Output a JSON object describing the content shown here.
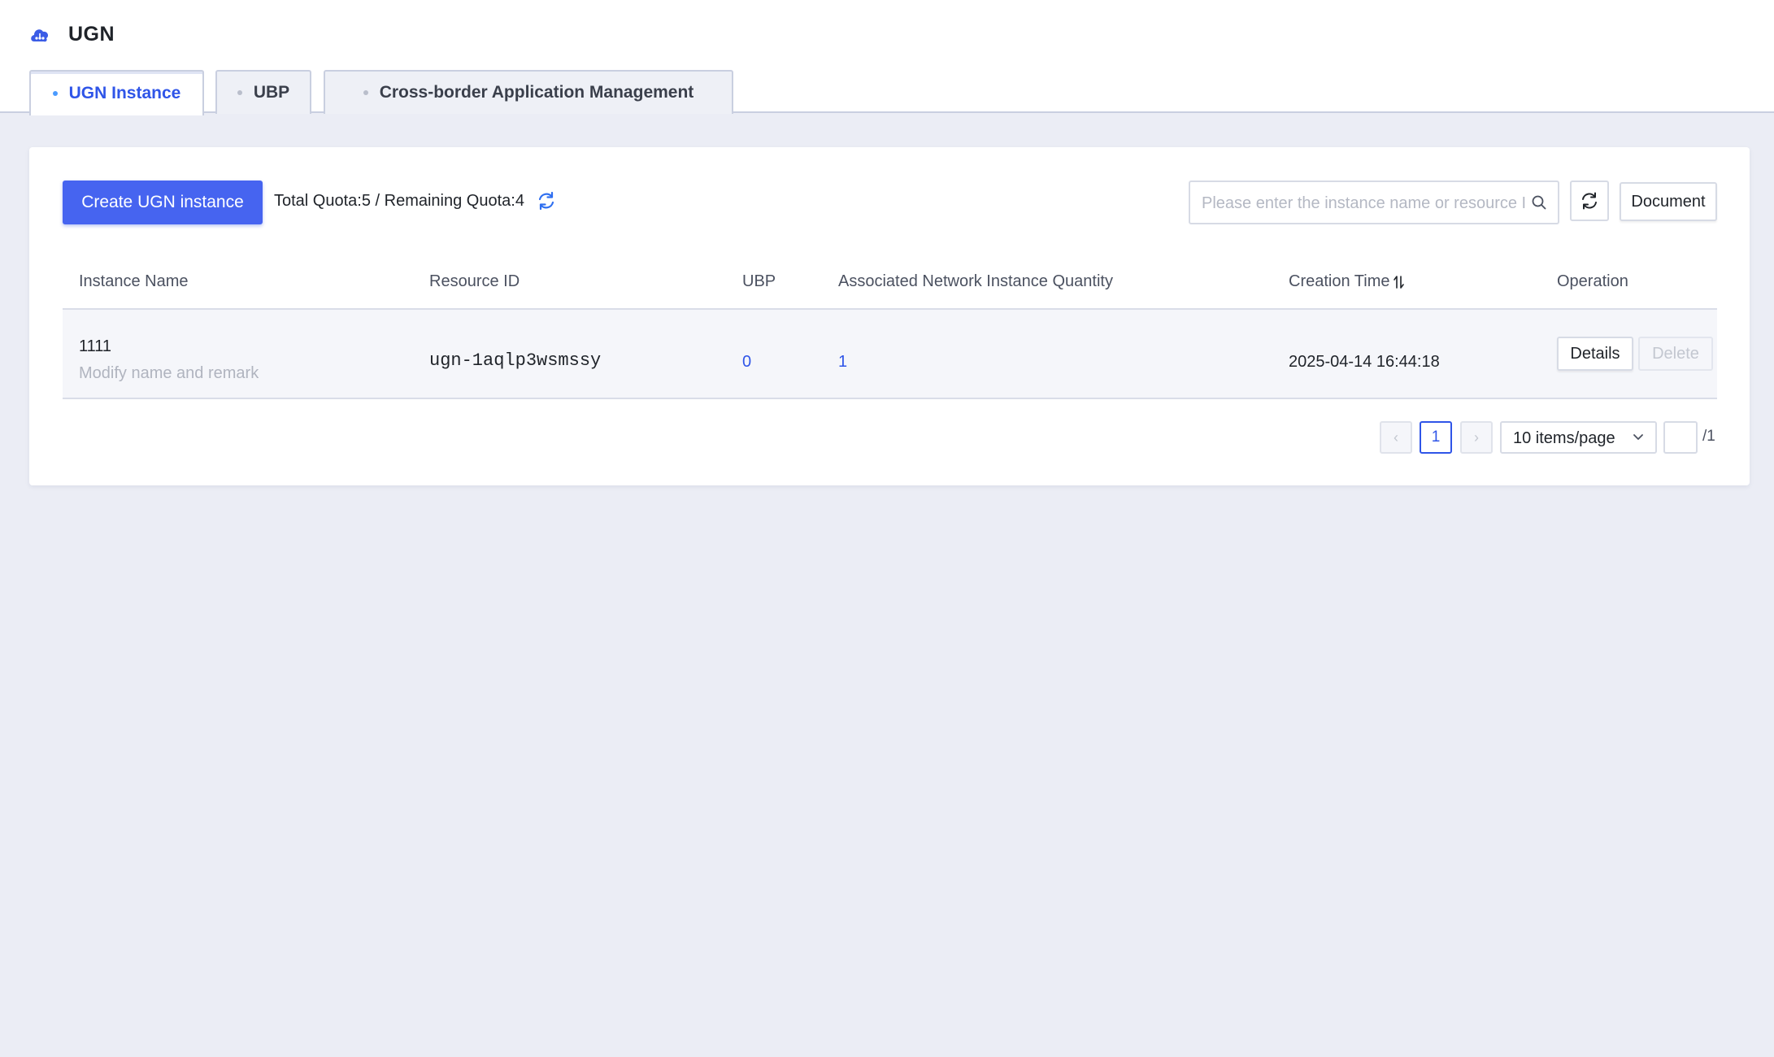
{
  "header": {
    "product_name": "UGN",
    "logo_icon": "cloud-network-icon"
  },
  "tabs": [
    {
      "label": "UGN Instance",
      "active": true
    },
    {
      "label": "UBP",
      "active": false
    },
    {
      "label": "Cross-border Application Management",
      "active": false
    }
  ],
  "toolbar": {
    "create_label": "Create UGN instance",
    "quota_text": "Total Quota:5 / Remaining Quota:4",
    "search_placeholder": "Please enter the instance name or resource ID",
    "document_label": "Document"
  },
  "table": {
    "columns": [
      "Instance Name",
      "Resource ID",
      "UBP",
      "Associated Network Instance Quantity",
      "Creation Time",
      "Operation"
    ],
    "rows": [
      {
        "instance_name": "1111",
        "remark_link": "Modify name and remark",
        "resource_id": "ugn-1aqlp3wsmssy",
        "ubp": "0",
        "associated_quantity": "1",
        "creation_time": "2025-04-14 16:44:18",
        "details_label": "Details",
        "delete_label": "Delete"
      }
    ]
  },
  "pagination": {
    "prev": "‹",
    "next": "›",
    "current_page": "1",
    "page_size": "10 items/page",
    "total_pages": "/1"
  },
  "colors": {
    "primary": "#4664f0",
    "link": "#2f55e8",
    "background": "#ebedf5"
  }
}
